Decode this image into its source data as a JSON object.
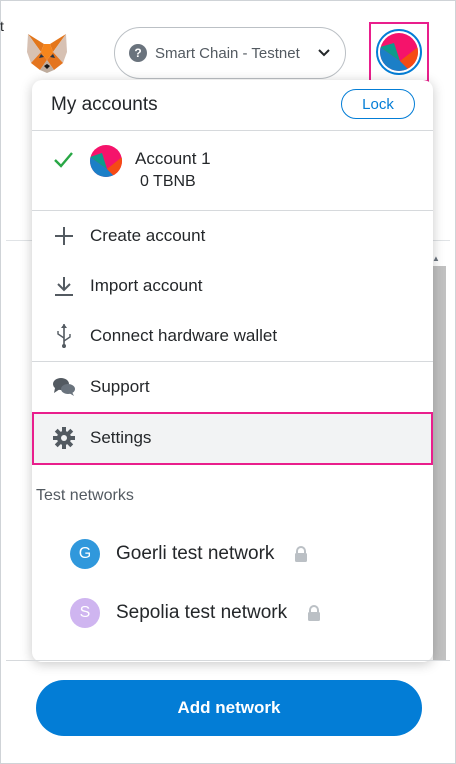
{
  "header": {
    "network_label": "Smart Chain - Testnet",
    "network_icon_char": "?"
  },
  "stray_text": "t",
  "menu": {
    "title": "My accounts",
    "lock_label": "Lock",
    "account": {
      "name": "Account 1",
      "balance": "0 TBNB"
    },
    "items": [
      {
        "label": "Create account",
        "icon": "plus-icon"
      },
      {
        "label": "Import account",
        "icon": "download-icon"
      },
      {
        "label": "Connect hardware wallet",
        "icon": "usb-icon"
      },
      {
        "label": "Support",
        "icon": "chat-icon"
      },
      {
        "label": "Settings",
        "icon": "gear-icon"
      }
    ]
  },
  "test_networks": {
    "heading": "Test networks",
    "networks": [
      {
        "initial": "G",
        "name": "Goerli test network",
        "color": "#3098dc"
      },
      {
        "initial": "S",
        "name": "Sepolia test network",
        "color": "#cfb5f0"
      }
    ]
  },
  "footer": {
    "add_network_label": "Add network"
  },
  "colors": {
    "accent": "#037dd6",
    "highlight": "#e91e8c",
    "check": "#28a745"
  }
}
